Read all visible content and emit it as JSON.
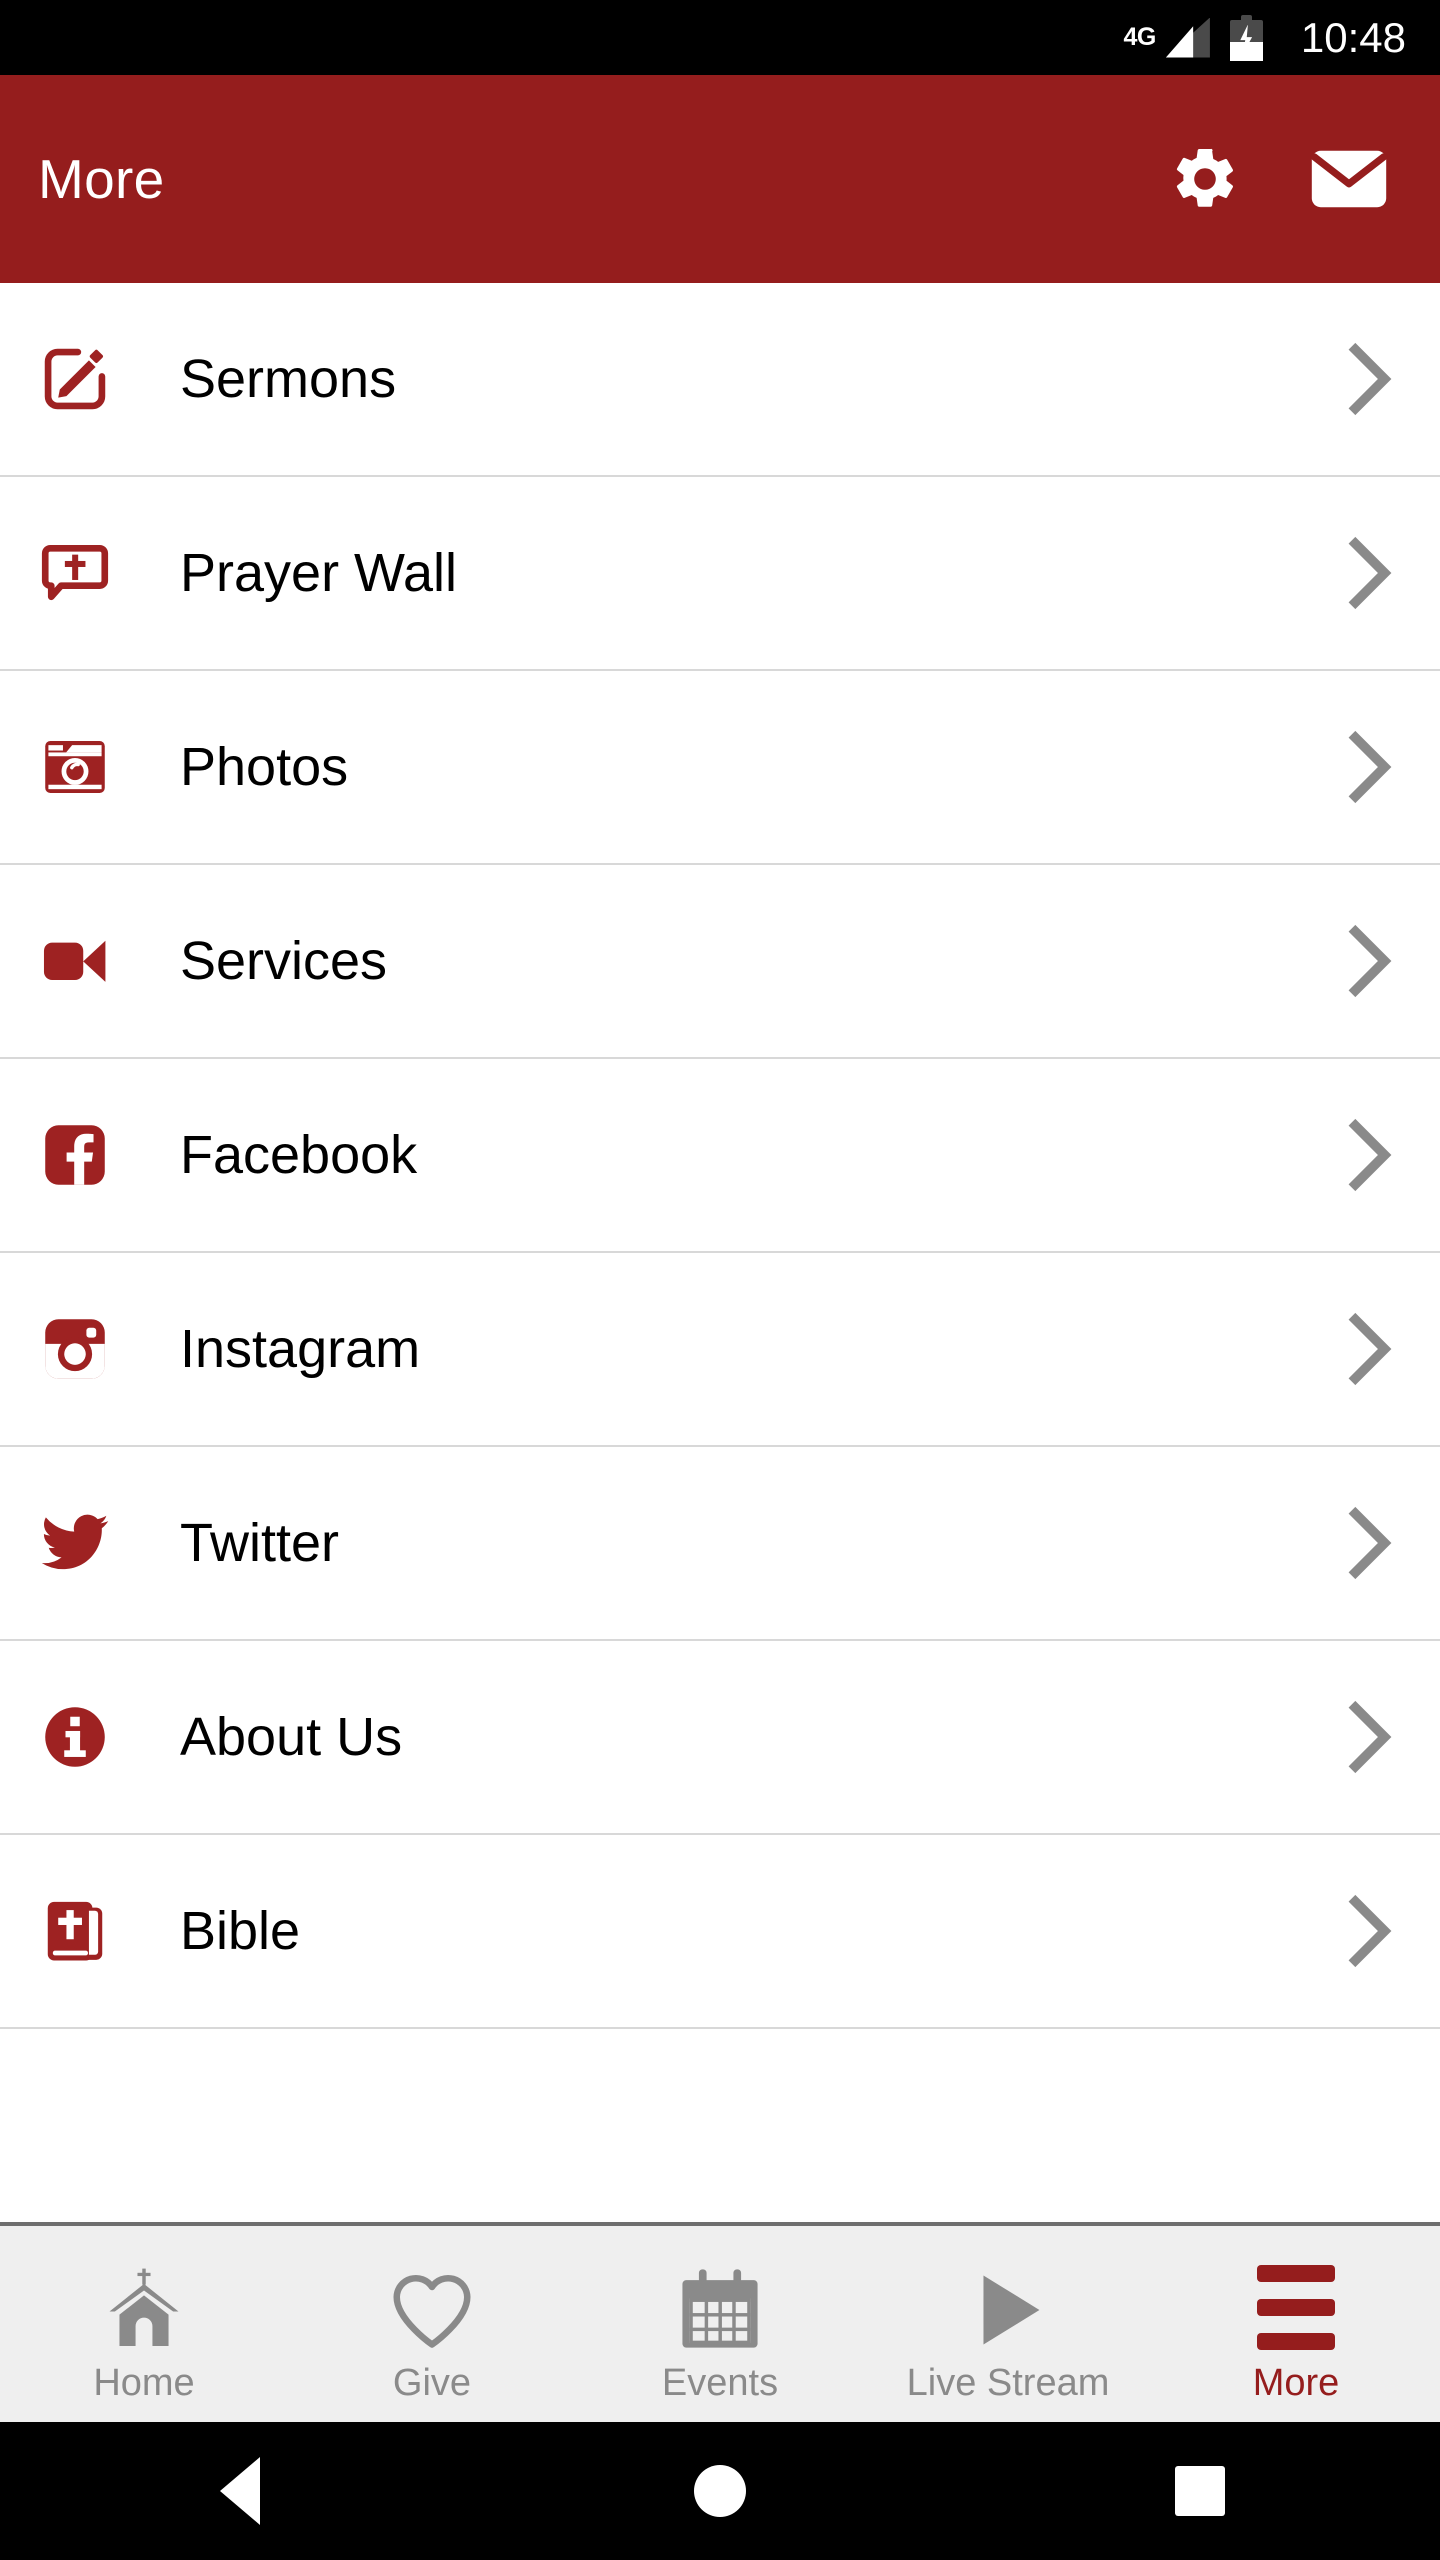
{
  "status_bar": {
    "network": "4G",
    "time": "10:48",
    "battery_state": "charging",
    "signal_icon": "signal-bars-icon",
    "battery_icon": "battery-charging-icon"
  },
  "app_bar": {
    "title": "More",
    "accent_color": "#951D1D",
    "actions": [
      {
        "name": "settings-button",
        "icon": "gear-icon"
      },
      {
        "name": "mail-button",
        "icon": "envelope-icon"
      }
    ]
  },
  "menu": {
    "items": [
      {
        "label": "Sermons",
        "icon": "edit-square-icon",
        "chevron": "chevron-right-icon"
      },
      {
        "label": "Prayer Wall",
        "icon": "speech-cross-icon",
        "chevron": "chevron-right-icon"
      },
      {
        "label": "Photos",
        "icon": "camera-icon",
        "chevron": "chevron-right-icon"
      },
      {
        "label": "Services",
        "icon": "video-camera-icon",
        "chevron": "chevron-right-icon"
      },
      {
        "label": "Facebook",
        "icon": "facebook-icon",
        "chevron": "chevron-right-icon"
      },
      {
        "label": "Instagram",
        "icon": "instagram-icon",
        "chevron": "chevron-right-icon"
      },
      {
        "label": "Twitter",
        "icon": "twitter-bird-icon",
        "chevron": "chevron-right-icon"
      },
      {
        "label": "About Us",
        "icon": "info-circle-icon",
        "chevron": "chevron-right-icon"
      },
      {
        "label": "Bible",
        "icon": "bible-book-icon",
        "chevron": "chevron-right-icon"
      }
    ]
  },
  "tab_bar": {
    "active_color": "#951D1D",
    "inactive_color": "#8a8a8a",
    "tabs": [
      {
        "label": "Home",
        "icon": "church-icon",
        "active": false
      },
      {
        "label": "Give",
        "icon": "heart-icon",
        "active": false
      },
      {
        "label": "Events",
        "icon": "calendar-icon",
        "active": false
      },
      {
        "label": "Live Stream",
        "icon": "play-icon",
        "active": false
      },
      {
        "label": "More",
        "icon": "hamburger-icon",
        "active": true
      }
    ]
  },
  "system_nav": {
    "buttons": [
      {
        "name": "back-button",
        "icon": "triangle-back-icon"
      },
      {
        "name": "home-button",
        "icon": "circle-home-icon"
      },
      {
        "name": "recents-button",
        "icon": "square-recents-icon"
      }
    ]
  }
}
